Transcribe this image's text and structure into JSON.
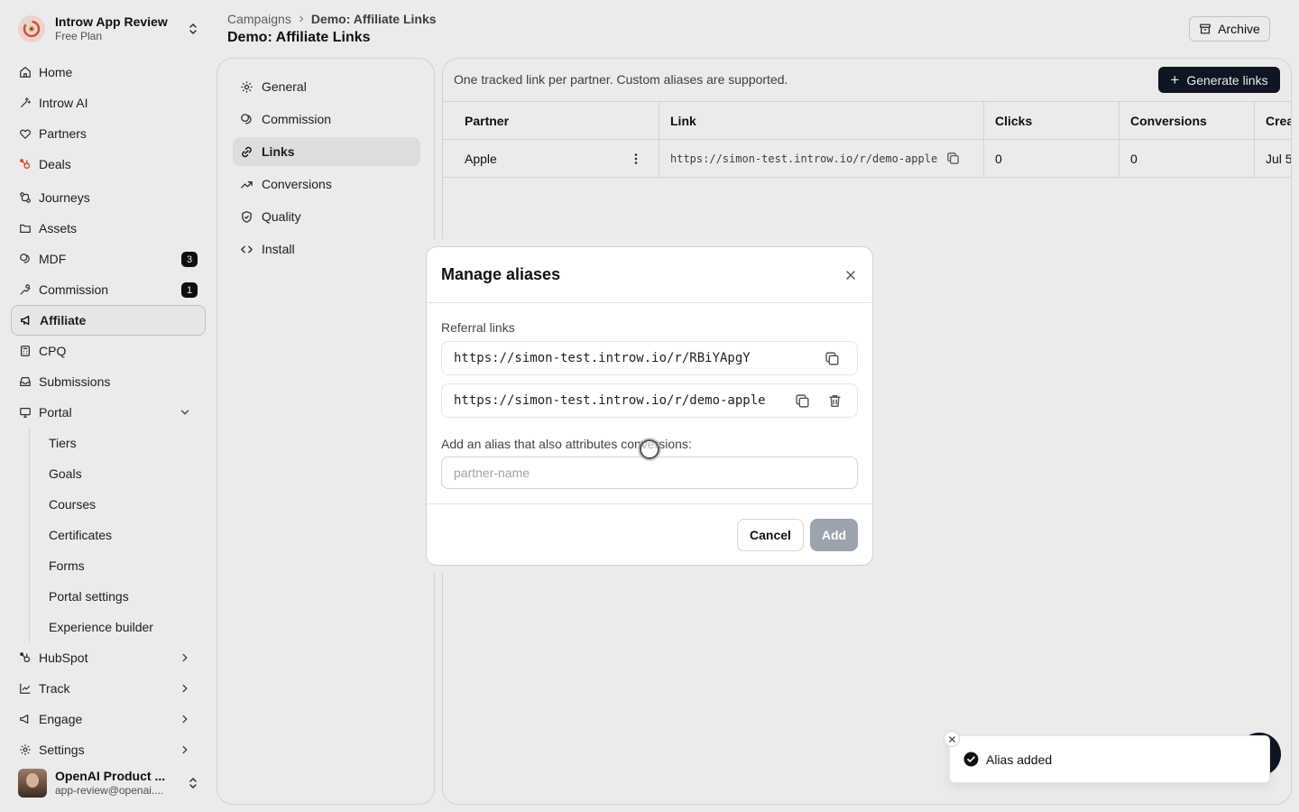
{
  "org": {
    "name": "Introw App Review",
    "plan": "Free Plan"
  },
  "nav": {
    "home": "Home",
    "ai": "Introw AI",
    "partners": "Partners",
    "deals": "Deals",
    "journeys": "Journeys",
    "assets": "Assets",
    "mdf": "MDF",
    "mdf_badge": "3",
    "commission": "Commission",
    "commission_badge": "1",
    "affiliate": "Affiliate",
    "cpq": "CPQ",
    "submissions": "Submissions",
    "portal": "Portal",
    "portal_sub": [
      "Tiers",
      "Goals",
      "Courses",
      "Certificates",
      "Forms",
      "Portal settings",
      "Experience builder"
    ],
    "hubspot": "HubSpot",
    "track": "Track",
    "engage": "Engage",
    "settings": "Settings"
  },
  "user": {
    "name": "OpenAI Product ...",
    "email": "app-review@openai...."
  },
  "breadcrumb": {
    "root": "Campaigns",
    "current": "Demo: Affiliate Links"
  },
  "page_title": "Demo: Affiliate Links",
  "archive_label": "Archive",
  "settings_nav": [
    "General",
    "Commission",
    "Links",
    "Conversions",
    "Quality",
    "Install"
  ],
  "content": {
    "description": "One tracked link per partner. Custom aliases are supported.",
    "generate_label": "Generate links",
    "columns": [
      "Partner",
      "Link",
      "Clicks",
      "Conversions",
      "Crea"
    ],
    "rows": [
      {
        "partner": "Apple",
        "link": "https://simon-test.introw.io/r/demo-apple",
        "clicks": "0",
        "conversions": "0",
        "created": "Jul 5"
      }
    ]
  },
  "modal": {
    "title": "Manage aliases",
    "referral_label": "Referral links",
    "links": [
      "https://simon-test.introw.io/r/RBiYApgY",
      "https://simon-test.introw.io/r/demo-apple"
    ],
    "alias_label": "Add an alias that also attributes conversions:",
    "alias_placeholder": "partner-name",
    "cancel_label": "Cancel",
    "add_label": "Add"
  },
  "toast": {
    "message": "Alias added"
  },
  "colors": {
    "primary_button": "#111827",
    "disabled_button": "#9ca3af",
    "badge": "#111111"
  }
}
